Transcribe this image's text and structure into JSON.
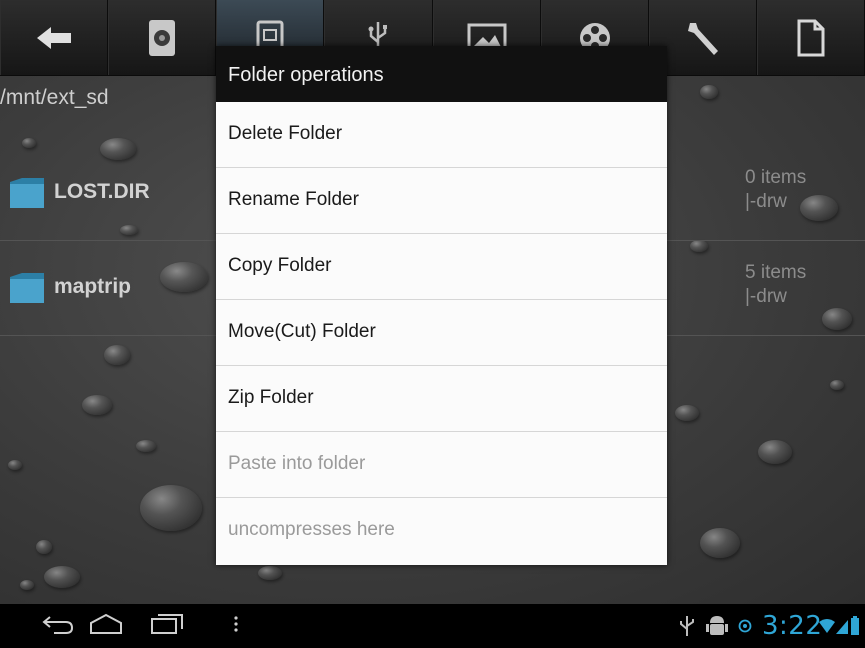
{
  "toolbar": {
    "buttons": [
      {
        "icon": "back-arrow-icon"
      },
      {
        "icon": "sd-card-icon"
      },
      {
        "icon": "internal-storage-icon",
        "active": true
      },
      {
        "icon": "usb-icon"
      },
      {
        "icon": "picture-icon"
      },
      {
        "icon": "film-reel-icon"
      },
      {
        "icon": "wrench-icon"
      },
      {
        "icon": "new-file-icon"
      }
    ]
  },
  "path": "/mnt/ext_sd",
  "files": [
    {
      "name": "LOST.DIR",
      "count": "0 items",
      "perm": "|-drw"
    },
    {
      "name": "maptrip",
      "count": "5 items",
      "perm": "|-drw"
    }
  ],
  "dialog": {
    "title": "Folder operations",
    "items": [
      {
        "label": "Delete Folder"
      },
      {
        "label": "Rename Folder"
      },
      {
        "label": "Copy Folder"
      },
      {
        "label": "Move(Cut) Folder"
      },
      {
        "label": "Zip Folder"
      },
      {
        "label": "Paste into folder",
        "disabled": true
      },
      {
        "label": "uncompresses here",
        "disabled": true
      }
    ]
  },
  "status": {
    "clock": "3:22",
    "accent": "#2fa6d6"
  }
}
